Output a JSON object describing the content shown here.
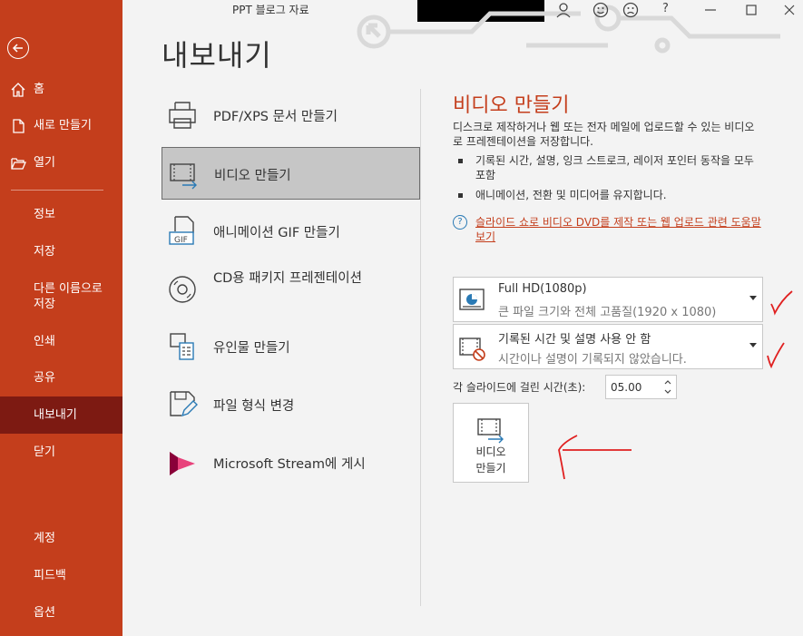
{
  "window": {
    "title": "PPT 블로그 자료",
    "help_label": "?"
  },
  "colors": {
    "accent": "#c43e1c",
    "sidebar_active": "#7d1a12"
  },
  "sidebar": {
    "top_items": [
      {
        "label": "홈",
        "icon": "home-icon"
      },
      {
        "label": "새로 만들기",
        "icon": "new-document-icon"
      },
      {
        "label": "열기",
        "icon": "folder-open-icon"
      }
    ],
    "items": [
      "정보",
      "저장",
      "다른 이름으로 저장",
      "인쇄",
      "공유",
      "내보내기",
      "닫기"
    ],
    "bottom_items": [
      "계정",
      "피드백",
      "옵션"
    ],
    "active": "내보내기"
  },
  "page": {
    "title": "내보내기"
  },
  "options": [
    {
      "label": "PDF/XPS 문서 만들기",
      "icon": "pdf-document-icon"
    },
    {
      "label": "비디오 만들기",
      "icon": "video-icon"
    },
    {
      "label": "애니메이션 GIF 만들기",
      "icon": "gif-icon"
    },
    {
      "label": "CD용 패키지 프레젠테이션",
      "icon": "cd-icon"
    },
    {
      "label": "유인물 만들기",
      "icon": "handout-icon"
    },
    {
      "label": "파일 형식 변경",
      "icon": "file-type-icon"
    },
    {
      "label": "Microsoft Stream에 게시",
      "icon": "stream-icon"
    }
  ],
  "selected_option": "비디오 만들기",
  "panel": {
    "title": "비디오 만들기",
    "description": "디스크로 제작하거나 웹 또는 전자 메일에 업로드할 수 있는 비디오로 프레젠테이션을 저장합니다.",
    "bullets": [
      "기록된 시간, 설명, 잉크 스트로크, 레이저 포인터 동작을 모두 포함",
      "애니메이션, 전환 및 미디어를 유지합니다."
    ],
    "help_link": "슬라이드 쇼로 비디오 DVD를 제작 또는 웹 업로드 관련 도움말 보기",
    "quality": {
      "main": "Full HD(1080p)",
      "sub": "큰 파일 크기와 전체 고품질(1920 x 1080)"
    },
    "timing": {
      "main": "기록된 시간 및 설명 사용 안 함",
      "sub": "시간이나 설명이 기록되지 않았습니다."
    },
    "seconds_label": "각 슬라이드에 걸린 시간(초):",
    "seconds_value": "05.00",
    "make_button": "비디오 만들기"
  }
}
